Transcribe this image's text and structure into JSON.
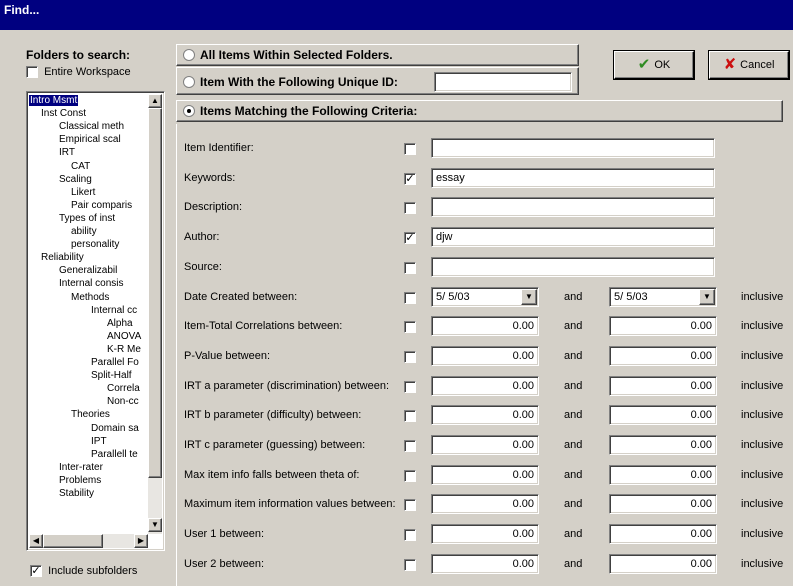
{
  "window": {
    "title": "Find..."
  },
  "folders": {
    "heading": "Folders to search:",
    "entire_workspace_label": "Entire Workspace",
    "entire_workspace_checked": false,
    "include_subfolders_label": "Include subfolders",
    "include_subfolders_checked": true,
    "tree": [
      {
        "label": "Intro Msmt",
        "indent": 0,
        "selected": true
      },
      {
        "label": "Inst Const",
        "indent": 1
      },
      {
        "label": "Classical meth",
        "indent": 2
      },
      {
        "label": "Empirical scal",
        "indent": 2
      },
      {
        "label": "IRT",
        "indent": 2
      },
      {
        "label": "CAT",
        "indent": 3
      },
      {
        "label": "Scaling",
        "indent": 2
      },
      {
        "label": "Likert",
        "indent": 3
      },
      {
        "label": "Pair comparis",
        "indent": 3
      },
      {
        "label": "Types of inst",
        "indent": 2
      },
      {
        "label": "ability",
        "indent": 3
      },
      {
        "label": "personality",
        "indent": 3
      },
      {
        "label": "Reliability",
        "indent": 1
      },
      {
        "label": "Generalizabil",
        "indent": 2
      },
      {
        "label": "Internal consis",
        "indent": 2
      },
      {
        "label": "Methods",
        "indent": 3
      },
      {
        "label": "Internal cc",
        "indent": 4
      },
      {
        "label": "Alpha",
        "indent": 5
      },
      {
        "label": "ANOVA",
        "indent": 5
      },
      {
        "label": "K-R Me",
        "indent": 5
      },
      {
        "label": "Parallel Fo",
        "indent": 4
      },
      {
        "label": "Split-Half",
        "indent": 4
      },
      {
        "label": "Correla",
        "indent": 5
      },
      {
        "label": "Non-cc",
        "indent": 5
      },
      {
        "label": "Theories",
        "indent": 3
      },
      {
        "label": "Domain sa",
        "indent": 4
      },
      {
        "label": "IPT",
        "indent": 4
      },
      {
        "label": "Parallell te",
        "indent": 4
      },
      {
        "label": "Inter-rater",
        "indent": 2
      },
      {
        "label": "Problems",
        "indent": 2
      },
      {
        "label": "Stability",
        "indent": 2
      }
    ]
  },
  "options": {
    "all_items": "All Items Within Selected Folders.",
    "unique_id": "Item With the Following Unique ID:",
    "unique_id_value": "",
    "criteria": "Items Matching the Following Criteria:",
    "selected": "criteria"
  },
  "buttons": {
    "ok": "OK",
    "cancel": "Cancel"
  },
  "text_criteria": [
    {
      "label": "Item Identifier:",
      "checked": false,
      "value": ""
    },
    {
      "label": "Keywords:",
      "checked": true,
      "value": "essay"
    },
    {
      "label": "Description:",
      "checked": false,
      "value": ""
    },
    {
      "label": "Author:",
      "checked": true,
      "value": "djw"
    },
    {
      "label": "Source:",
      "checked": false,
      "value": ""
    }
  ],
  "date_criterion": {
    "label": "Date Created between:",
    "checked": false,
    "from": "5/  5/03",
    "to": "5/  5/03",
    "and": "and",
    "inclusive": "inclusive"
  },
  "range_criteria": [
    {
      "label": "Item-Total Correlations between:",
      "checked": false,
      "from": "0.00",
      "to": "0.00",
      "and": "and",
      "inclusive": "inclusive"
    },
    {
      "label": "P-Value between:",
      "checked": false,
      "from": "0.00",
      "to": "0.00",
      "and": "and",
      "inclusive": "inclusive"
    },
    {
      "label": "IRT a parameter (discrimination) between:",
      "checked": false,
      "from": "0.00",
      "to": "0.00",
      "and": "and",
      "inclusive": "inclusive"
    },
    {
      "label": "IRT b parameter (difficulty) between:",
      "checked": false,
      "from": "0.00",
      "to": "0.00",
      "and": "and",
      "inclusive": "inclusive"
    },
    {
      "label": "IRT c parameter (guessing) between:",
      "checked": false,
      "from": "0.00",
      "to": "0.00",
      "and": "and",
      "inclusive": "inclusive"
    },
    {
      "label": "Max item info falls between theta of:",
      "checked": false,
      "from": "0.00",
      "to": "0.00",
      "and": "and",
      "inclusive": "inclusive"
    },
    {
      "label": "Maximum item information values between:",
      "checked": false,
      "from": "0.00",
      "to": "0.00",
      "and": "and",
      "inclusive": "inclusive"
    },
    {
      "label": "User 1 between:",
      "checked": false,
      "from": "0.00",
      "to": "0.00",
      "and": "and",
      "inclusive": "inclusive"
    },
    {
      "label": "User 2 between:",
      "checked": false,
      "from": "0.00",
      "to": "0.00",
      "and": "and",
      "inclusive": "inclusive"
    }
  ],
  "colors": {
    "title_bar": "#000080",
    "face": "#d4d0c8",
    "ok_icon": "#2e8b22",
    "cancel_icon": "#cc1010"
  }
}
